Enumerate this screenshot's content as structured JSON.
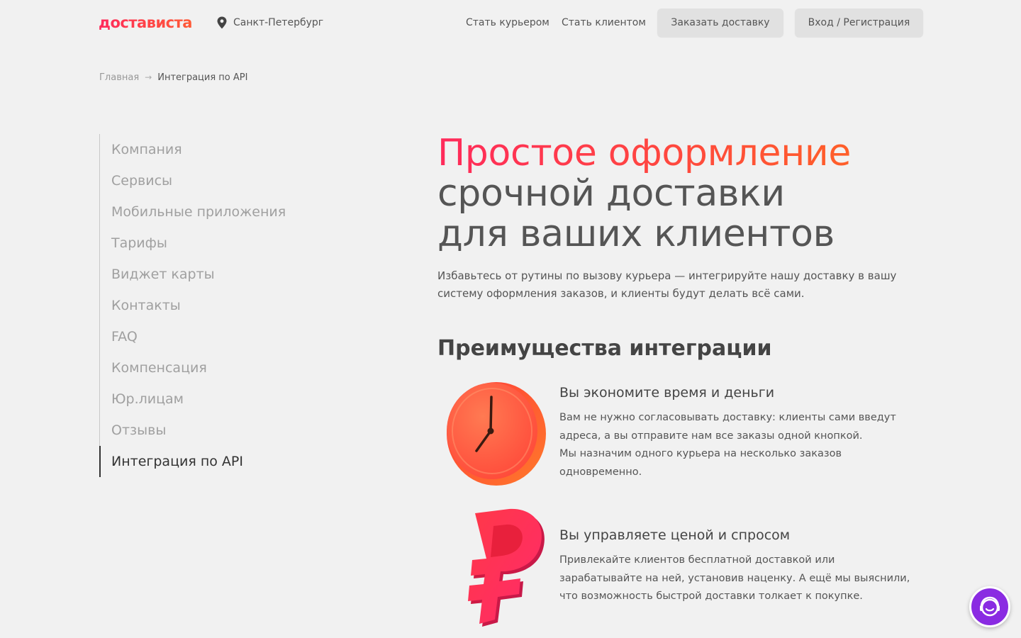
{
  "header": {
    "logo": "достависта",
    "city": "Санкт-Петербург",
    "nav": {
      "courier": "Стать курьером",
      "client": "Стать клиентом"
    },
    "order_button": "Заказать доставку",
    "login_button": "Вход / Регистрация"
  },
  "breadcrumb": {
    "home": "Главная",
    "separator": "→",
    "current": "Интеграция по API"
  },
  "sidebar": {
    "items": [
      {
        "label": "Компания"
      },
      {
        "label": "Сервисы"
      },
      {
        "label": "Мобильные приложения"
      },
      {
        "label": "Тарифы"
      },
      {
        "label": "Виджет карты"
      },
      {
        "label": "Контакты"
      },
      {
        "label": "FAQ"
      },
      {
        "label": "Компенсация"
      },
      {
        "label": "Юр.лицам"
      },
      {
        "label": "Отзывы"
      },
      {
        "label": "Интеграция по API"
      }
    ],
    "active_index": 10
  },
  "hero": {
    "title_highlight": "Простое оформление",
    "title_line2": "срочной доставки",
    "title_line3": "для ваших клиентов",
    "subtitle_line1": "Избавьтесь от рутины по вызову курьера — интегрируйте нашу доставку в вашу",
    "subtitle_line2": "систему оформления заказов, и клиенты будут делать всё сами."
  },
  "advantages": {
    "title": "Преимущества интеграции",
    "items": [
      {
        "icon": "clock-icon",
        "title": "Вы экономите время и деньги",
        "lines": [
          "Вам не нужно согласовывать доставку: клиенты сами введут",
          "адреса, а вы отправите нам все заказы одной кнопкой.",
          "Мы назначим одного курьера на несколько заказов",
          "одновременно."
        ]
      },
      {
        "icon": "ruble-icon",
        "title": "Вы управляете ценой и спросом",
        "lines": [
          "Привлекайте клиентов бесплатной доставкой или",
          "зарабатывайте на ней, установив наценку. А ещё мы выяснили,",
          "что возможность быстрой доставки толкает к покупке."
        ]
      }
    ]
  },
  "colors": {
    "background": "#f1f1f1",
    "brand_start": "#ff2a5b",
    "brand_end": "#ff6a1f",
    "chat": "#8a2be2"
  }
}
